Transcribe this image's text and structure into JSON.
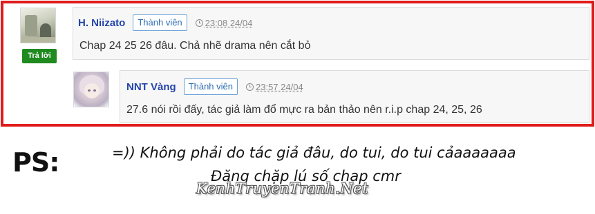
{
  "comments": [
    {
      "username": "H. Niizato",
      "role": "Thành viên",
      "time": "23:08 24/04",
      "text": "Chap 24 25 26 đâu. Chả nhẽ drama nên cắt bỏ",
      "reply_label": "Trả lời"
    },
    {
      "username": "NNT Vàng",
      "role": "Thành viên",
      "time": "23:57 24/04",
      "text": "27.6 nói rồi đấy, tác giả làm đổ mực ra bản thảo nên r.i.p chap 24, 25, 26"
    }
  ],
  "note": {
    "label": "PS:",
    "line1": "=)) Không phải do tác giả đâu, do tui, do tui cảaaaaaaa",
    "line2": "Đăng chặp lú số chap cmr"
  },
  "watermark": "KenhTruyenTranh.Net",
  "colors": {
    "frame": "#e01b1b",
    "username": "#2244aa",
    "reply_button": "#1f8a1f",
    "badge_border": "#6aa0d6"
  },
  "icons": [
    "clock-icon",
    "avatar"
  ]
}
